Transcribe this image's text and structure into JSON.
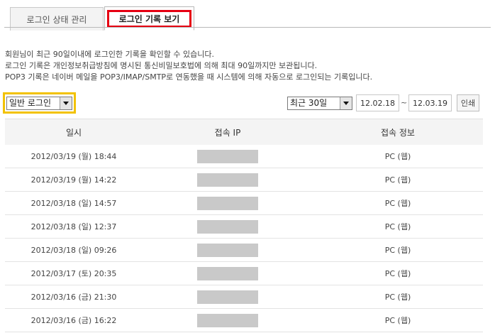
{
  "tabs": [
    {
      "label": "로그인 상태 관리"
    },
    {
      "label": "로그인 기록 보기"
    }
  ],
  "description": [
    "회원님이 최근 90일이내에 로그인한 기록을 확인할 수 있습니다.",
    "로그인 기록은 개인정보취급방침에 명시된 통신비밀보호법에 의해 최대 90일까지만 보관됩니다.",
    "POP3 기록은 네이버 메일을 POP3/IMAP/SMTP로 연동했을 때 시스템에 의해 자동으로 로그인되는 기록입니다."
  ],
  "filters": {
    "login_type": "일반 로그인",
    "period": "최근 30일",
    "date_from": "12.02.18",
    "date_to": "12.03.19",
    "range_separator": "~",
    "print_label": "인쇄"
  },
  "table": {
    "headers": [
      "일시",
      "접속 IP",
      "접속 정보"
    ],
    "rows": [
      {
        "datetime": "2012/03/19 (월) 18:44",
        "info": "PC (웹)"
      },
      {
        "datetime": "2012/03/19 (월) 14:22",
        "info": "PC (웹)"
      },
      {
        "datetime": "2012/03/18 (일) 14:57",
        "info": "PC (웹)"
      },
      {
        "datetime": "2012/03/18 (일) 12:37",
        "info": "PC (웹)"
      },
      {
        "datetime": "2012/03/18 (일) 09:26",
        "info": "PC (웹)"
      },
      {
        "datetime": "2012/03/17 (토) 20:35",
        "info": "PC (웹)"
      },
      {
        "datetime": "2012/03/16 (금) 21:30",
        "info": "PC (웹)"
      },
      {
        "datetime": "2012/03/16 (금) 16:22",
        "info": "PC (웹)"
      }
    ]
  },
  "colors": {
    "active_tab_highlight": "#e60012",
    "filter_highlight": "#f2c200",
    "masked_ip": "#c9c9c9"
  }
}
